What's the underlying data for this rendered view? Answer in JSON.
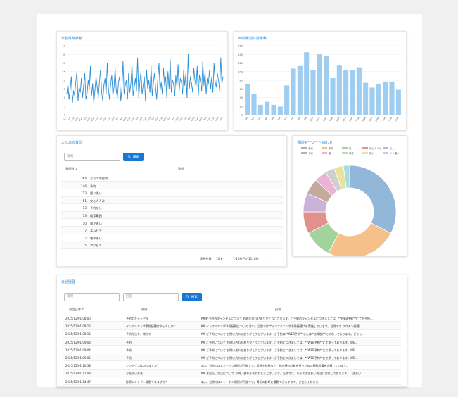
{
  "panels": {
    "line_title": "日別件数推移",
    "bar_title": "時間帯別件数推移",
    "faq_title": "よくある質問",
    "donut_title": "質問キーワードTop10",
    "history_title": "会話履歴"
  },
  "faq": {
    "search_placeholder": "質問",
    "search_button": "検索",
    "col_count": "質問数",
    "col_question": "質問",
    "rows": [
      {
        "count": "364",
        "question": "おおての受取"
      },
      {
        "count": "146",
        "question": "予約"
      },
      {
        "count": "113",
        "question": "量り違い"
      },
      {
        "count": "51",
        "question": "安心ＡＡ沙"
      },
      {
        "count": "13",
        "question": "予約なし"
      },
      {
        "count": "13",
        "question": "検索範囲"
      },
      {
        "count": "10",
        "question": "量が違い"
      },
      {
        "count": "7",
        "question": "ユムセラ"
      },
      {
        "count": "7",
        "question": "電の違い"
      },
      {
        "count": "5",
        "question": "アクセス"
      }
    ],
    "page_size_label": "表示件数",
    "page_size": "10",
    "page_range": "1-10件目 / 1118件"
  },
  "history": {
    "search_placeholder_1": "質問",
    "search_placeholder_2": "回答",
    "search_button": "検索",
    "col_date": "受信日時",
    "col_question": "質問",
    "col_answer": "回答",
    "rows": [
      {
        "date": "2025/12/01 08:00",
        "question": "予約のキャンセル",
        "answer": "### 予約のキャンセルについて お問い合わせありがとうございます。ご予約のキャンセルにつきましては、**WEB予約**にてお手続…"
      },
      {
        "date": "2025/12/01 08:16",
        "question": "インフルエンザ予防接種はやっていか？",
        "answer": "## インフルエンザ予防接種について はい、当院では**インフルエンザ予防接種**を実施しています。当院での ワクチン接種…"
      },
      {
        "date": "2025/12/01 08:16",
        "question": "予約方法を、教えて",
        "answer": "## ご予約について お問い合わせありがとうございます。ご予約は**WEB予約**または**お電話**にて承っております。どちら…"
      },
      {
        "date": "2025/12/01 09:03",
        "question": "予約",
        "answer": "## ご予約について お問い合わせありがとうございます。ご予約につきましては、**WEB予約**にて承っております。WE…"
      },
      {
        "date": "2025/12/01 09:04",
        "question": "予約",
        "answer": "## ご予約について お問い合わせありがとうございます。ご予約につきましては、**WEB予約**にて承っております。WE…"
      },
      {
        "date": "2025/12/01 09:05",
        "question": "予約",
        "answer": "## ご予約について お問い合わせありがとうございます。ご予約につきましては、**WEB予約**にて承っております。WE…"
      },
      {
        "date": "2025/12/01 10:58",
        "question": "レントゲンはありますか？",
        "answer": "はい、当院ではレントゲン撮影が可能です。骨折や捻挫など、各診療の診断を行うための撮影設備を完備しています。"
      },
      {
        "date": "2025/12/01 11:48",
        "question": "お支払い方法",
        "answer": "## お支払い方法について お問い合わせありがとうございます。当院では、以下のお支払い方法に対応しております。（支払い…"
      },
      {
        "date": "2025/12/01 14:47",
        "question": "診察レントゲン撮影できますか？",
        "answer": "はい、当院ではレントゲン撮影が可能です。骨折の診断に撮影できますので、ご安心ください。"
      }
    ]
  },
  "chart_data": [
    {
      "type": "line",
      "title": "日別件数推移",
      "ylim": [
        0,
        40
      ],
      "yticks": [
        "0",
        "5",
        "10",
        "15",
        "20",
        "25",
        "30",
        "35",
        "40"
      ],
      "xticks": [
        "1/1",
        "1/8",
        "1/15",
        "1/22",
        "1/29",
        "2/5",
        "2/12",
        "2/19",
        "2/26",
        "3/5",
        "3/12",
        "3/19",
        "3/26",
        "4/2",
        "4/9",
        "4/16",
        "4/23",
        "4/30",
        "5/7",
        "5/14",
        "5/21",
        "5/28",
        "6/4",
        "6/11",
        "6/18",
        "6/25",
        "7/2",
        "7/9",
        "7/16",
        "7/23",
        "7/30",
        "8/6",
        "8/13",
        "8/20",
        "8/27",
        "9/3",
        "9/10",
        "9/17",
        "9/24",
        "10/1"
      ],
      "values": [
        12,
        18,
        9,
        15,
        22,
        7,
        14,
        11,
        19,
        25,
        8,
        16,
        13,
        21,
        10,
        17,
        24,
        9,
        12,
        20,
        15,
        28,
        11,
        18,
        7,
        14,
        22,
        16,
        10,
        19,
        26,
        13,
        8,
        17,
        21,
        12,
        30,
        15,
        9,
        18,
        23,
        11,
        16,
        27,
        14,
        10,
        19,
        22,
        8,
        15,
        31,
        12,
        17,
        20,
        9,
        24,
        13,
        18,
        29,
        11,
        16,
        21,
        14,
        33,
        10,
        19,
        25,
        12,
        17,
        22,
        8,
        26,
        15,
        20,
        13,
        28,
        11,
        18,
        24,
        16,
        9,
        21,
        30,
        14,
        19,
        12,
        27,
        17,
        22,
        10,
        25,
        15,
        32,
        13,
        20,
        18,
        11,
        23,
        16,
        29,
        14,
        21,
        19,
        12,
        26,
        17,
        24,
        10,
        35,
        15,
        22,
        18,
        13,
        27,
        20,
        16,
        28,
        11,
        23,
        19,
        14,
        31,
        17,
        25,
        12,
        21,
        18,
        26,
        15,
        22,
        13,
        30,
        19,
        16,
        24,
        20,
        14,
        33,
        18,
        22
      ],
      "grid": true
    },
    {
      "type": "bar",
      "title": "時間帯別件数推移",
      "ylim": [
        0,
        160
      ],
      "yticks": [
        "0",
        "20",
        "40",
        "60",
        "80",
        "100",
        "120",
        "140",
        "160"
      ],
      "categories": [
        "0時",
        "1時",
        "2時",
        "3時",
        "4時",
        "5時",
        "6時",
        "7時",
        "8時",
        "9時",
        "10時",
        "11時",
        "12時",
        "13時",
        "14時",
        "15時",
        "16時",
        "17時",
        "18時",
        "19時",
        "20時",
        "21時",
        "22時",
        "23時"
      ],
      "values": [
        72,
        48,
        23,
        30,
        23,
        19,
        68,
        107,
        113,
        145,
        103,
        140,
        136,
        85,
        114,
        103,
        104,
        110,
        74,
        63,
        72,
        77,
        77,
        58
      ],
      "color": "#9fcdf0",
      "grid": true
    },
    {
      "type": "pie",
      "title": "質問キーワードTop10",
      "donut": true,
      "labels": [
        "予約",
        "予約",
        "量",
        "安心ＡＡ沙",
        "なし",
        "予約",
        "量",
        "診療",
        "揃い",
        "ソリ違い"
      ],
      "values": [
        30,
        23,
        9,
        7,
        6,
        5,
        4,
        3,
        3,
        2
      ],
      "colors": [
        "#93b7d8",
        "#f5c08c",
        "#a3d39c",
        "#e2908c",
        "#c9b3d9",
        "#c4a99c",
        "#ebb4d2",
        "#cfcfcf",
        "#e8e3a0",
        "#a9dbe6"
      ],
      "legend": "top"
    }
  ]
}
